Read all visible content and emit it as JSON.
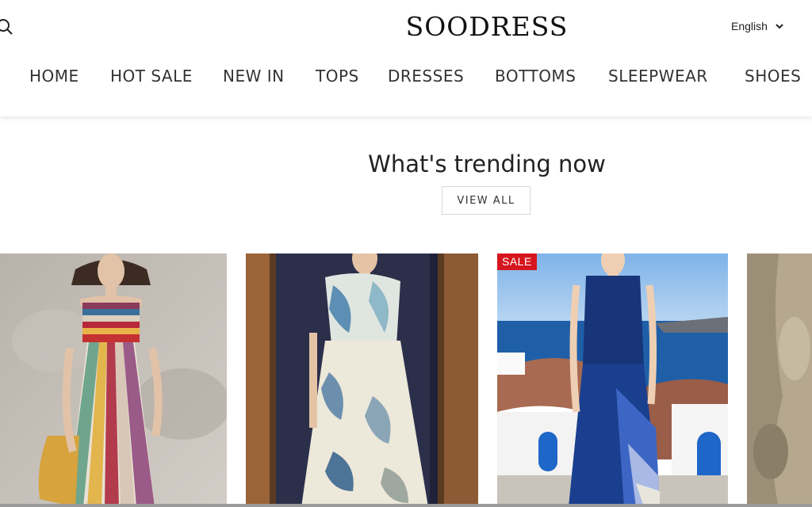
{
  "header": {
    "logo": "SOODRESS",
    "language": "English",
    "icons": {
      "search": "search-icon",
      "language_toggle": "chevron-down-icon"
    }
  },
  "nav": {
    "items": [
      {
        "label": "HOME"
      },
      {
        "label": "HOT SALE"
      },
      {
        "label": "NEW IN"
      },
      {
        "label": "TOPS"
      },
      {
        "label": "DRESSES"
      },
      {
        "label": "BOTTOMS"
      },
      {
        "label": "SLEEPWEAR"
      },
      {
        "label": "SHOES"
      }
    ]
  },
  "trending": {
    "title": "What's trending now",
    "view_all": "VIEW ALL",
    "products": [
      {
        "badge": ""
      },
      {
        "badge": ""
      },
      {
        "badge": "SALE"
      },
      {
        "badge": ""
      }
    ]
  },
  "colors": {
    "sale_badge": "#d6161e",
    "text": "#222222",
    "border": "#d7d7d7"
  }
}
